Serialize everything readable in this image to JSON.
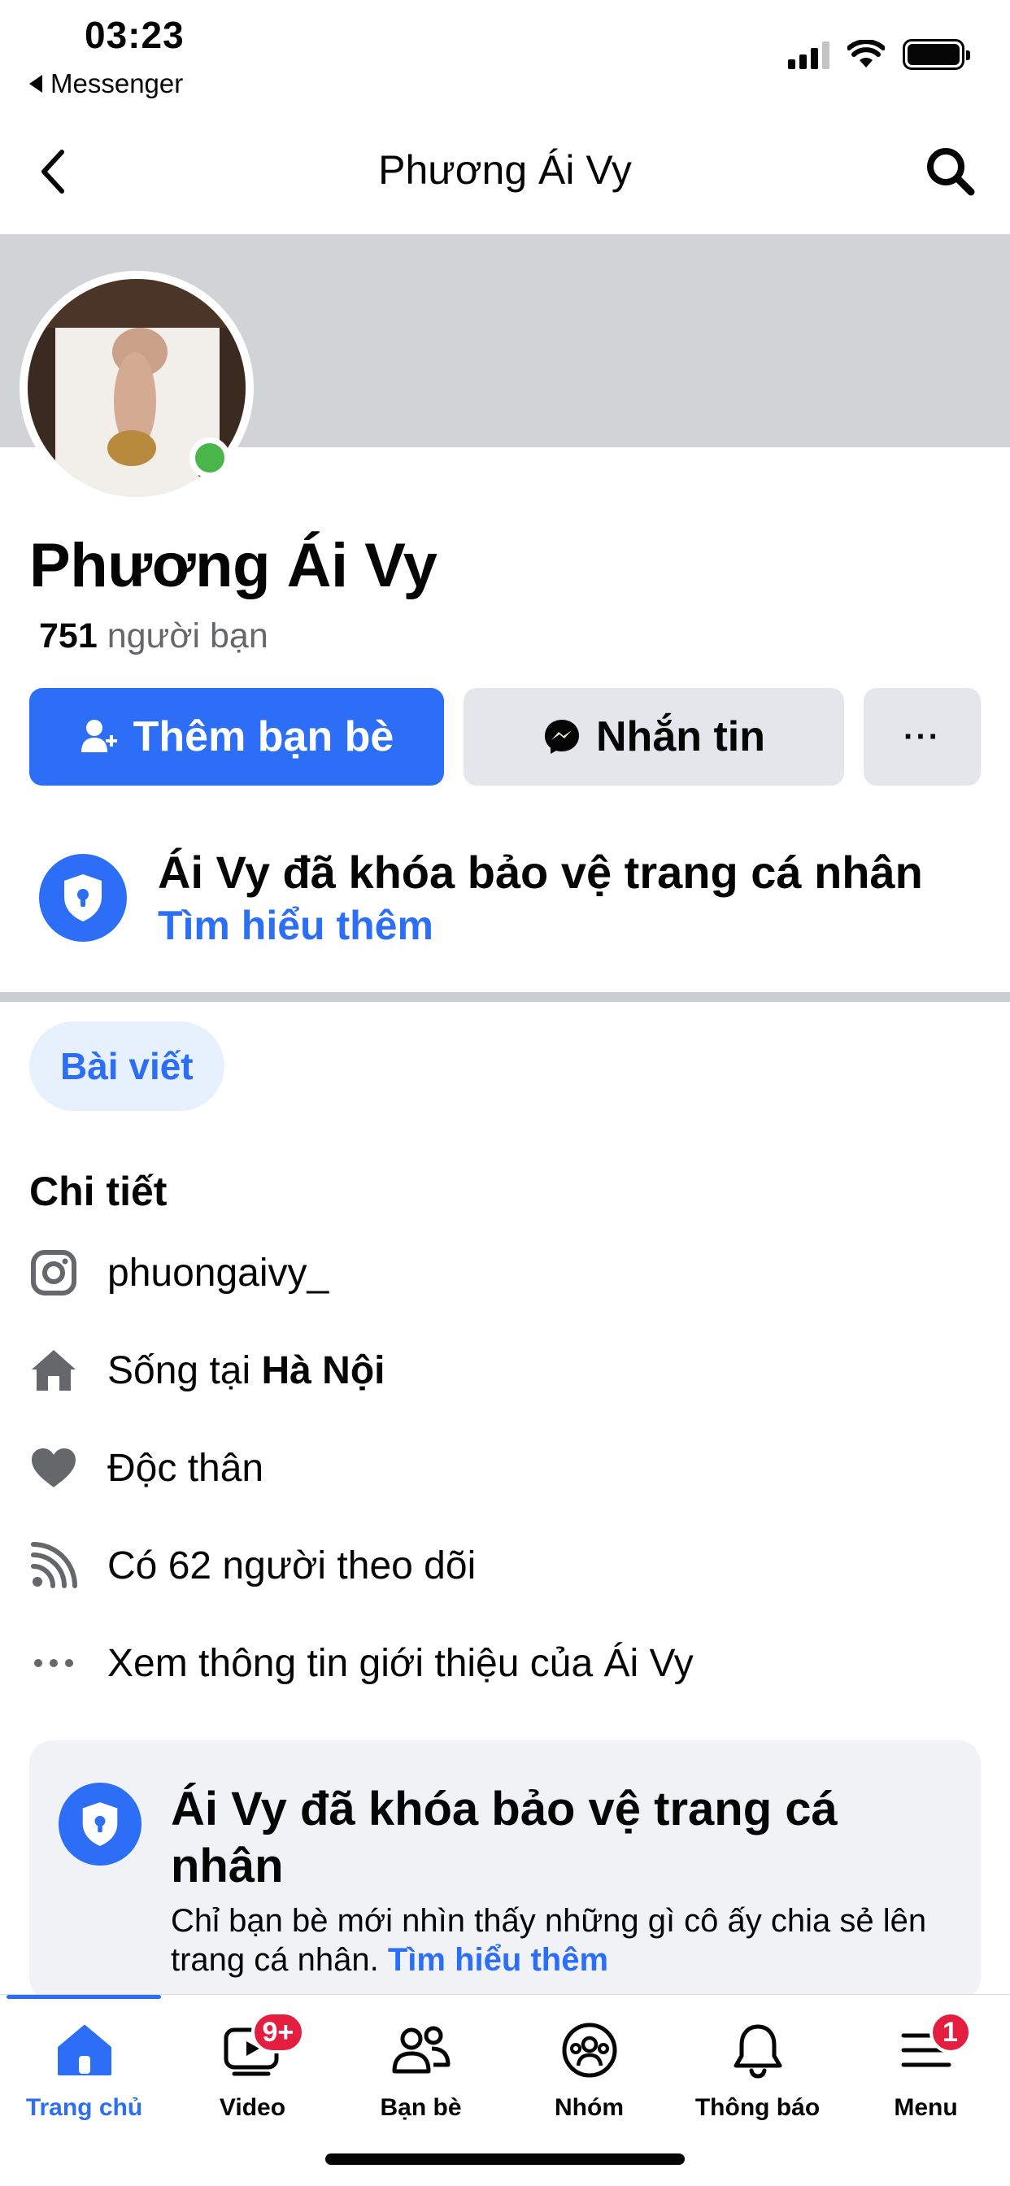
{
  "status_bar": {
    "time": "03:23",
    "back_app": "Messenger"
  },
  "header": {
    "title": "Phương Ái Vy"
  },
  "profile": {
    "name": "Phương Ái Vy",
    "friend_count": "751",
    "friend_label": "người bạn",
    "online": true
  },
  "actions": {
    "add_friend": "Thêm bạn bè",
    "message": "Nhắn tin",
    "more": "···"
  },
  "lock_notice": {
    "title": "Ái Vy đã khóa bảo vệ trang cá nhân",
    "link": "Tìm hiểu thêm"
  },
  "tabs": {
    "posts": "Bài viết"
  },
  "details": {
    "title": "Chi tiết",
    "instagram": "phuongaivy_",
    "lives_in_prefix": "Sống tại",
    "lives_in_city": "Hà Nội",
    "relationship": "Độc thân",
    "followers": "Có 62 người theo dõi",
    "see_about": "Xem thông tin giới thiệu của Ái Vy"
  },
  "lock_card": {
    "title": "Ái Vy đã khóa bảo vệ trang cá nhân",
    "text": "Chỉ bạn bè mới nhìn thấy những gì cô ấy chia sẻ lên trang cá nhân.",
    "link": "Tìm hiểu thêm"
  },
  "bottom_nav": {
    "items": [
      {
        "label": "Trang chủ",
        "icon": "home-icon",
        "active": true
      },
      {
        "label": "Video",
        "icon": "video-icon",
        "badge": "9+"
      },
      {
        "label": "Bạn bè",
        "icon": "friends-icon"
      },
      {
        "label": "Nhóm",
        "icon": "groups-icon"
      },
      {
        "label": "Thông báo",
        "icon": "bell-icon"
      },
      {
        "label": "Menu",
        "icon": "menu-icon",
        "badge": "1"
      }
    ]
  },
  "colors": {
    "accent": "#2d6ef6",
    "online": "#4ab549",
    "badge": "#e41e3f",
    "button_gray": "#e4e6eb"
  }
}
